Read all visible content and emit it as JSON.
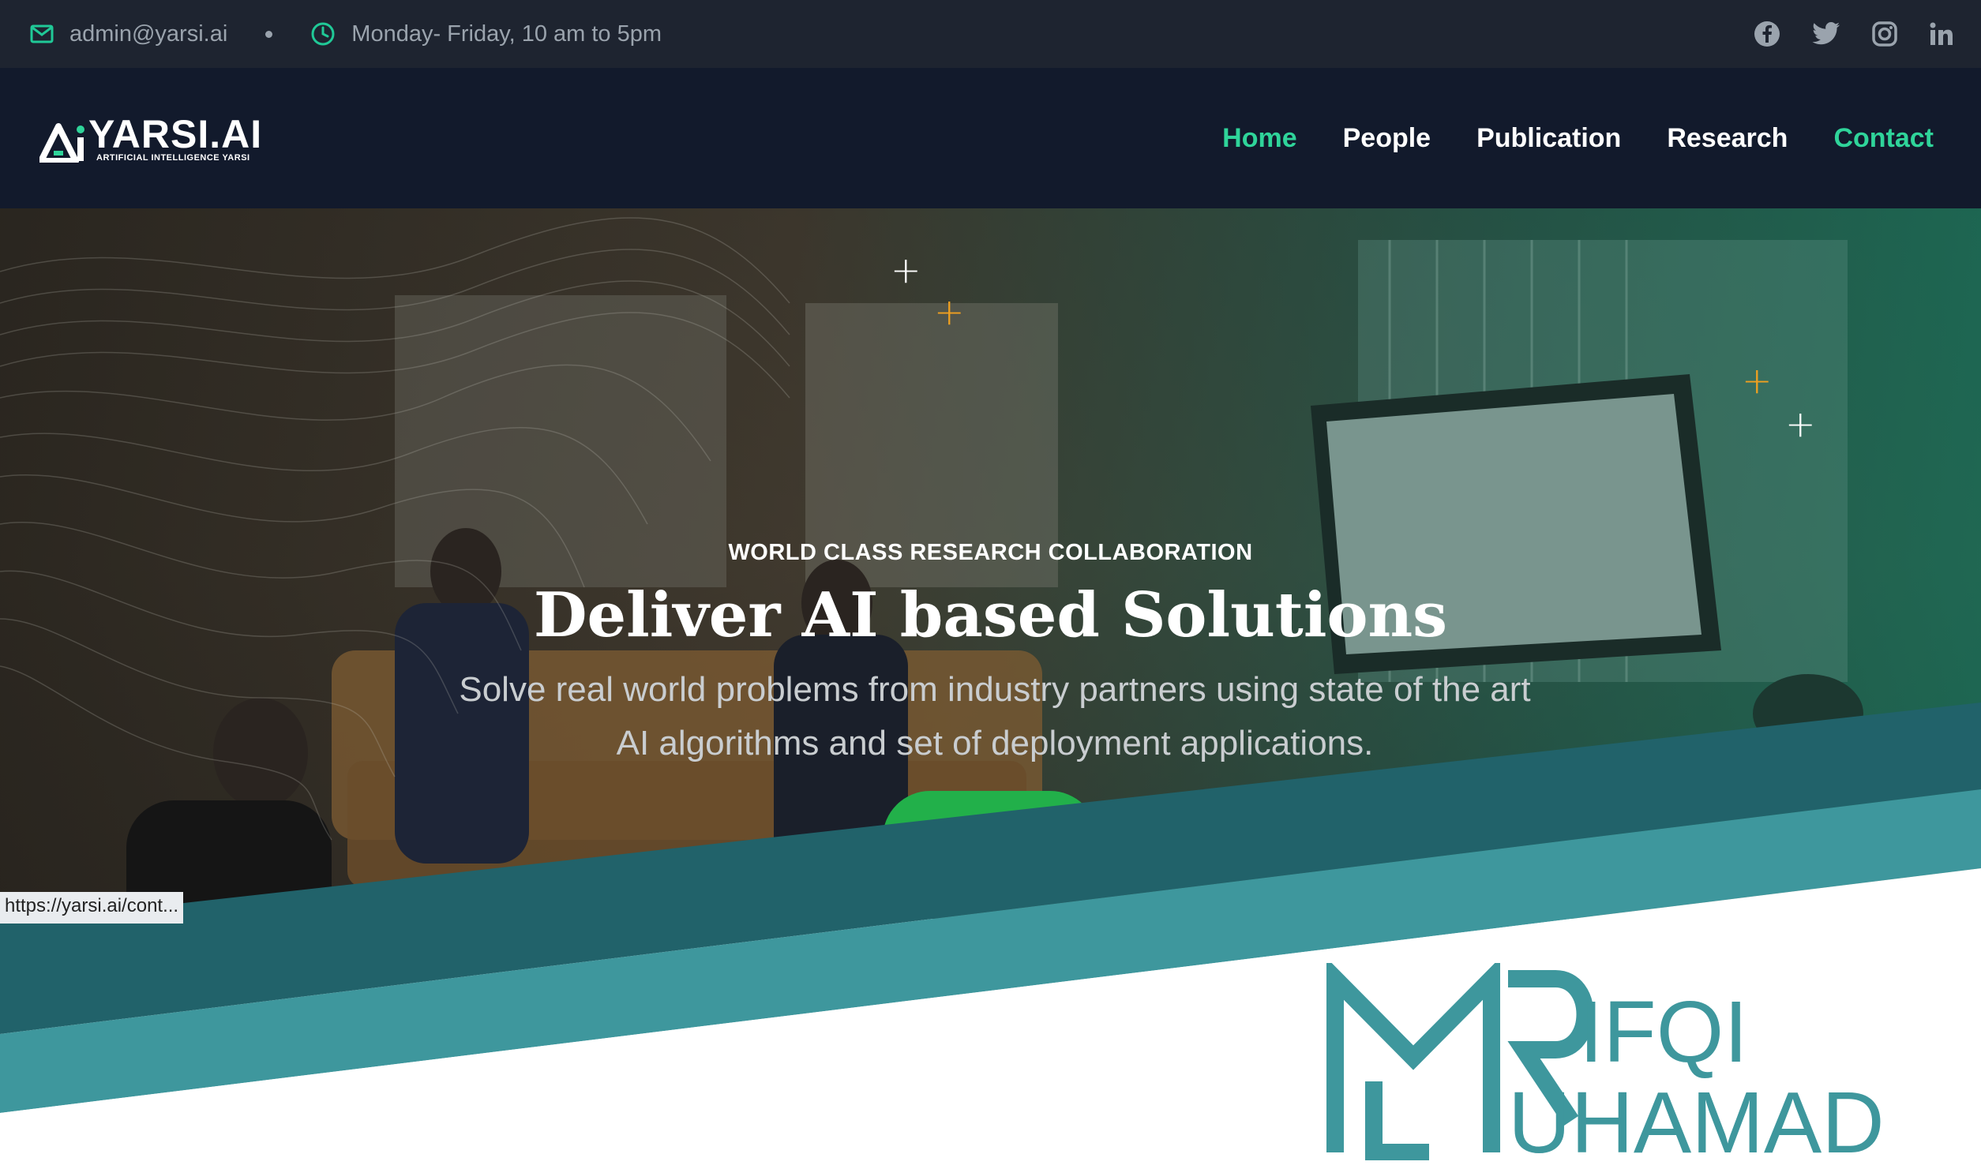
{
  "topbar": {
    "email": "admin@yarsi.ai",
    "hours": "Monday- Friday, 10 am to 5pm",
    "socials": [
      "facebook-icon",
      "twitter-icon",
      "instagram-icon",
      "linkedin-icon"
    ]
  },
  "brand": {
    "name": "YARSI.AI",
    "tagline": "ARTIFICIAL INTELLIGENCE YARSI"
  },
  "nav": {
    "items": [
      {
        "label": "Home",
        "active": true
      },
      {
        "label": "People",
        "active": false
      },
      {
        "label": "Publication",
        "active": false
      },
      {
        "label": "Research",
        "active": false
      },
      {
        "label": "Contact",
        "active": false
      }
    ]
  },
  "hero": {
    "eyebrow": "WORLD CLASS RESEARCH COLLABORATION",
    "title": "Deliver AI based Solutions",
    "description": "Solve real world problems from industry partners using state of the art AI algorithms and set of deployment applications."
  },
  "status_url": "https://yarsi.ai/cont...",
  "watermark": {
    "line1": "IFQI",
    "line2": "UHAMAD"
  },
  "colors": {
    "accent": "#2fd49a",
    "topbar_bg": "#1e2430",
    "nav_bg": "#121a2c",
    "band_dark": "#21626a",
    "band_light": "#3e979d",
    "button": "#22b04a"
  }
}
